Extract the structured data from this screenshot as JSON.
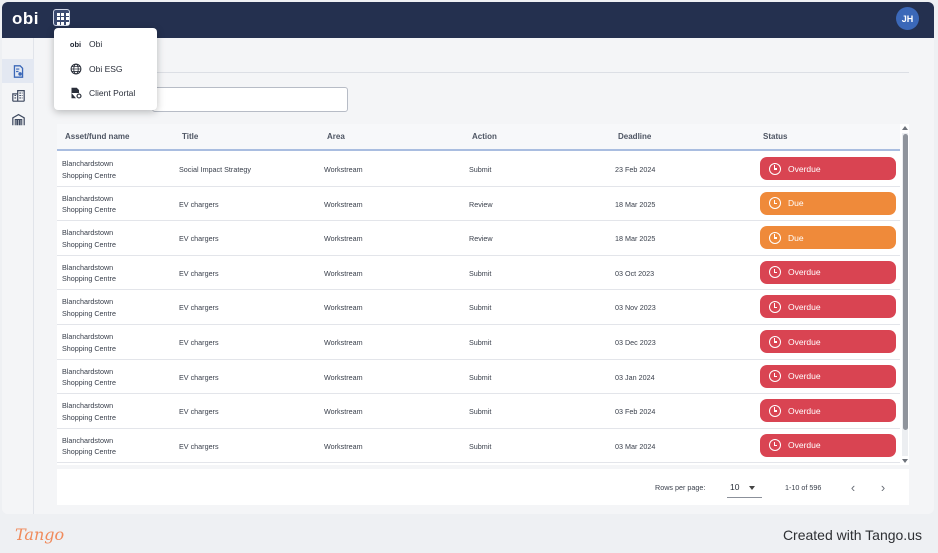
{
  "app": {
    "logo": "obi",
    "user_initials": "JH",
    "colors": {
      "topbar": "#24304f",
      "overdue": "#d94452",
      "due": "#ef8a3a",
      "accent": "#3b68b8"
    }
  },
  "app_menu": {
    "items": [
      {
        "label": "Obi",
        "icon": "obi-logo-icon",
        "icon_text": "obi"
      },
      {
        "label": "Obi ESG",
        "icon": "globe-icon"
      },
      {
        "label": "Client Portal",
        "icon": "document-gear-icon"
      }
    ]
  },
  "sidebar": {
    "items": [
      {
        "icon": "document-icon",
        "active": true
      },
      {
        "icon": "buildings-icon",
        "active": false
      },
      {
        "icon": "warehouse-icon",
        "active": false
      }
    ]
  },
  "table": {
    "columns": [
      "Asset/fund name",
      "Title",
      "Area",
      "Action",
      "Deadline",
      "Status"
    ],
    "rows": [
      {
        "asset_line1": "Blanchardstown",
        "asset_line2": "Shopping Centre",
        "title": "Social Impact Strategy",
        "area": "Workstream",
        "action": "Submit",
        "deadline": "23 Feb 2024",
        "status": "Overdue"
      },
      {
        "asset_line1": "Blanchardstown",
        "asset_line2": "Shopping Centre",
        "title": "EV chargers",
        "area": "Workstream",
        "action": "Review",
        "deadline": "18 Mar 2025",
        "status": "Due"
      },
      {
        "asset_line1": "Blanchardstown",
        "asset_line2": "Shopping Centre",
        "title": "EV chargers",
        "area": "Workstream",
        "action": "Review",
        "deadline": "18 Mar 2025",
        "status": "Due"
      },
      {
        "asset_line1": "Blanchardstown",
        "asset_line2": "Shopping Centre",
        "title": "EV chargers",
        "area": "Workstream",
        "action": "Submit",
        "deadline": "03 Oct 2023",
        "status": "Overdue"
      },
      {
        "asset_line1": "Blanchardstown",
        "asset_line2": "Shopping Centre",
        "title": "EV chargers",
        "area": "Workstream",
        "action": "Submit",
        "deadline": "03 Nov 2023",
        "status": "Overdue"
      },
      {
        "asset_line1": "Blanchardstown",
        "asset_line2": "Shopping Centre",
        "title": "EV chargers",
        "area": "Workstream",
        "action": "Submit",
        "deadline": "03 Dec 2023",
        "status": "Overdue"
      },
      {
        "asset_line1": "Blanchardstown",
        "asset_line2": "Shopping Centre",
        "title": "EV chargers",
        "area": "Workstream",
        "action": "Submit",
        "deadline": "03 Jan 2024",
        "status": "Overdue"
      },
      {
        "asset_line1": "Blanchardstown",
        "asset_line2": "Shopping Centre",
        "title": "EV chargers",
        "area": "Workstream",
        "action": "Submit",
        "deadline": "03 Feb 2024",
        "status": "Overdue"
      },
      {
        "asset_line1": "Blanchardstown",
        "asset_line2": "Shopping Centre",
        "title": "EV chargers",
        "area": "Workstream",
        "action": "Submit",
        "deadline": "03 Mar 2024",
        "status": "Overdue"
      }
    ]
  },
  "pagination": {
    "rows_per_page_label": "Rows per page:",
    "rows_per_page": "10",
    "range": "1-10 of 596",
    "prev": "‹",
    "next": "›"
  },
  "watermark": {
    "logo": "Tango",
    "credit": "Created with Tango.us"
  }
}
